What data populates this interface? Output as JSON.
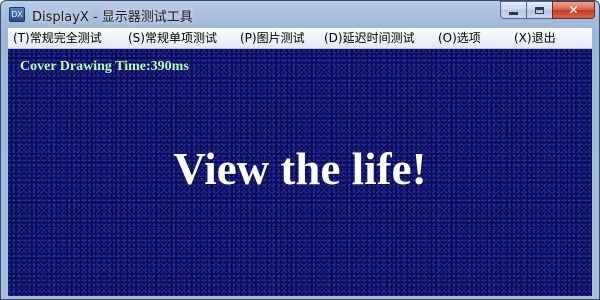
{
  "window": {
    "icon_label": "DX",
    "title": "DisplayX - 显示器测试工具"
  },
  "caption_buttons": {
    "minimize": "minimize-icon",
    "maximize": "maximize-icon",
    "close": "close-icon",
    "close_glyph": "✕"
  },
  "menu": {
    "items": [
      {
        "label": "(T)常规完全测试"
      },
      {
        "label": "(S)常规单项测试"
      },
      {
        "label": "(P)图片测试"
      },
      {
        "label": "(D)延迟时间测试"
      },
      {
        "label": "(O)选项"
      },
      {
        "label": "(X)退出"
      }
    ]
  },
  "canvas": {
    "timing_text": "Cover Drawing Time:390ms",
    "headline": "View the life!"
  },
  "colors": {
    "canvas_background": "#0a0c58",
    "timing_text": "#b6ffb0",
    "headline_text": "#ffffff",
    "close_button": "#c43c1f"
  }
}
